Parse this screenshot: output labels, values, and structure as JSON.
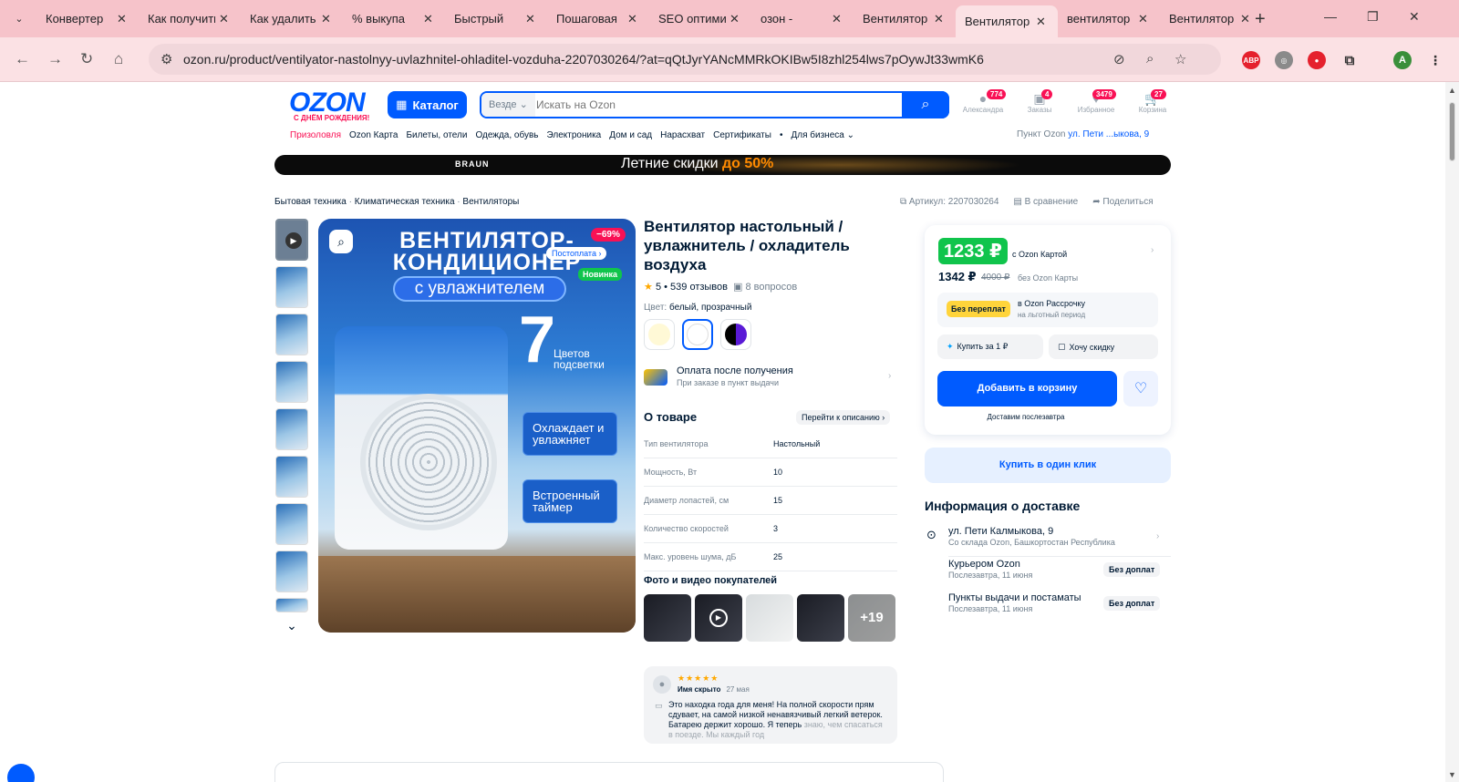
{
  "browser": {
    "tabs": [
      {
        "title": "Конвертер",
        "fav": "G",
        "kind": "g"
      },
      {
        "title": "Как получить",
        "fav": "▶",
        "kind": "vc"
      },
      {
        "title": "Как удалить",
        "fav": "",
        "kind": "o"
      },
      {
        "title": "% выкупа",
        "fav": "G",
        "kind": "g"
      },
      {
        "title": "Быстрый",
        "fav": "",
        "kind": "o"
      },
      {
        "title": "Пошаговая",
        "fav": "G",
        "kind": "g"
      },
      {
        "title": "SEO оптимизация",
        "fav": "W",
        "kind": "w"
      },
      {
        "title": "озон -",
        "fav": "G",
        "kind": "g"
      },
      {
        "title": "Вентилятор",
        "fav": "",
        "kind": "oz"
      },
      {
        "title": "Вентилятор",
        "fav": "",
        "kind": "oz",
        "active": true
      },
      {
        "title": "вентилятор",
        "fav": "",
        "kind": "oz"
      },
      {
        "title": "Вентилятор",
        "fav": "",
        "kind": "oz"
      }
    ],
    "url": "ozon.ru/product/ventilyator-nastolnyy-uvlazhnitel-ohladitel-vozduha-2207030264/?at=qQtJyrYANcMMRkOKIBw5I8zhl254lws7pOywJt33wmK6",
    "profile_initial": "A",
    "ext_abp": "ABP"
  },
  "header": {
    "logo": "OZON",
    "logo_sub": "С ДНЁМ РОЖДЕНИЯ!",
    "catalog": "Каталог",
    "search_scope": "Везде",
    "search_placeholder": "Искать на Ozon",
    "icons": [
      {
        "label": "Александра",
        "badge": "774"
      },
      {
        "label": "Заказы",
        "badge": "4"
      },
      {
        "label": "Избранное",
        "badge": "3479"
      },
      {
        "label": "Корзина",
        "badge": "27"
      }
    ],
    "menu": [
      "Призоловля",
      "Ozon Карта",
      "Билеты, отели",
      "Одежда, обувь",
      "Электроника",
      "Дом и сад",
      "Нарасхват",
      "Сертификаты",
      "•",
      "Для бизнеса ⌄"
    ],
    "pickup_label": "Пункт Ozon",
    "pickup_address": "ул. Пети ...ыкова, 9"
  },
  "banner": {
    "brand": "BRAUN",
    "text": "Летние скидки",
    "accent": "до 50%"
  },
  "breadcrumbs": [
    "Бытовая техника",
    "Климатическая техника",
    "Вентиляторы"
  ],
  "article": {
    "label": "Артикул: 2207030264",
    "compare": "В сравнение",
    "share": "Поделиться"
  },
  "image": {
    "title": "ВЕНТИЛЯТОР-КОНДИЦИОНЕР",
    "pill": "с увлажнителем",
    "discount": "−69%",
    "postpay": "Постоплата ›",
    "new": "Новинка",
    "number": "7",
    "number_text": "Цветов подсветки",
    "box1": "Охлаждает и увлажняет",
    "box2": "Встроенный таймер"
  },
  "product": {
    "title": "Вентилятор настольный / увлажнитель / охладитель воздуха",
    "rating": "5",
    "reviews": "539 отзывов",
    "questions": "8 вопросов",
    "color_label": "Цвет:",
    "color_value": "белый, прозрачный",
    "swatch_colors": [
      "#fff9d6",
      "#ffffff",
      "#2d0a6b"
    ],
    "payafter_title": "Оплата после получения",
    "payafter_sub": "При заказе в пункт выдачи",
    "about_title": "О товаре",
    "about_link": "Перейти к описанию ›",
    "specs": [
      {
        "k": "Тип вентилятора",
        "v": "Настольный"
      },
      {
        "k": "Мощность, Вт",
        "v": "10"
      },
      {
        "k": "Диаметр лопастей, см",
        "v": "15"
      },
      {
        "k": "Количество скоростей",
        "v": "3"
      },
      {
        "k": "Макс. уровень шума, дБ",
        "v": "25"
      }
    ],
    "photos_title": "Фото и видео покупателей",
    "photos_more": "+19"
  },
  "review": {
    "stars": "★★★★★",
    "author": "Имя скрыто",
    "date": "27 мая",
    "text": "Это находка года для меня! На полной скорости прям сдувает, на самой низкой ненавязчивый легкий ветерок. Батарею держит хорошо. Я теперь",
    "text_fade": "знаю, чем спасаться в поезде. Мы каждый год"
  },
  "price": {
    "card_price": "1233 ₽",
    "card_label": "с Ozon Картой",
    "price": "1342 ₽",
    "old_price": "4000 ₽",
    "no_card_label": "без Ozon Карты",
    "installment_badge": "Без переплат",
    "installment_title": "в Ozon Рассрочку",
    "installment_sub": "на льготный период",
    "buy_for_1": "Купить за 1 ₽",
    "want_discount": "Хочу скидку",
    "add_to_cart": "Добавить в корзину",
    "delivery_date": "Доставим послезавтра",
    "one_click": "Купить в один клик"
  },
  "delivery": {
    "title": "Информация о доставке",
    "address": "ул. Пети Калмыкова, 9",
    "address_sub": "Со склада Ozon, Башкортостан Республика",
    "courier": "Курьером Ozon",
    "courier_date": "Послезавтра, 11 июня",
    "courier_tag": "Без доплат",
    "points": "Пункты выдачи и постаматы",
    "points_date": "Послезавтра, 11 июня",
    "points_tag": "Без доплат"
  },
  "colors": {
    "ozon_blue": "#005bff",
    "ozon_pink": "#f91155",
    "green": "#10c44c",
    "chrome_pink": "#f6c3ca"
  }
}
